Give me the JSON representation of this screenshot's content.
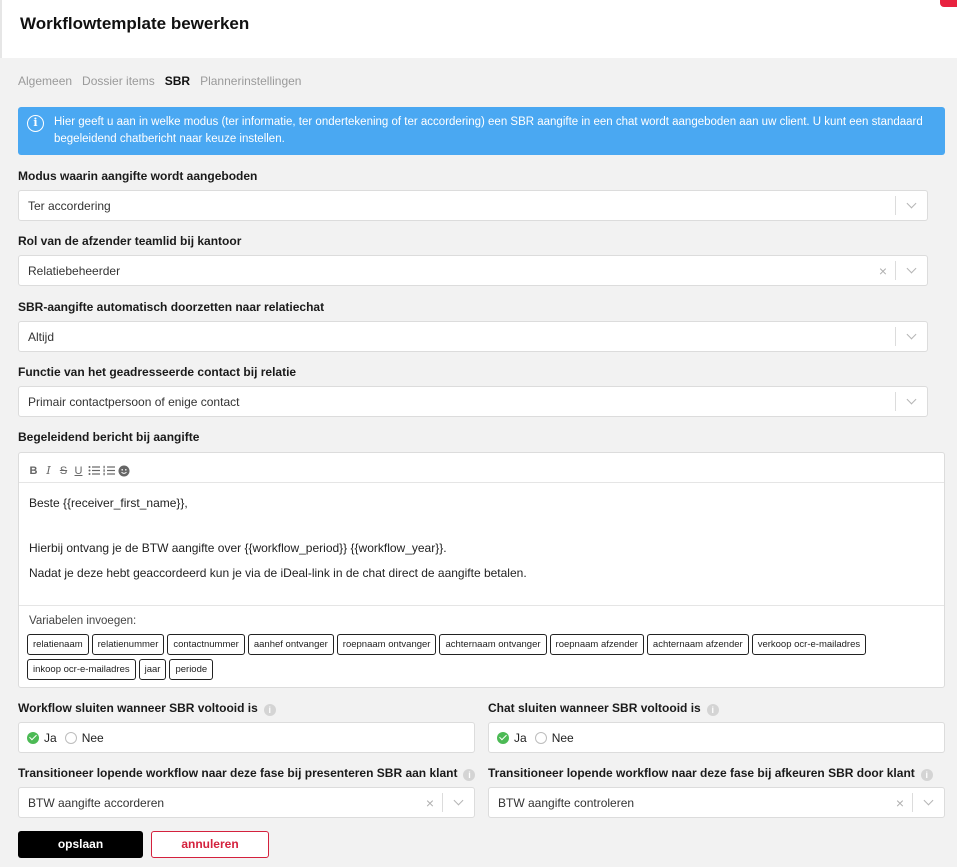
{
  "title": "Workflowtemplate bewerken",
  "tabs": [
    {
      "label": "Algemeen",
      "active": false
    },
    {
      "label": "Dossier items",
      "active": false
    },
    {
      "label": "SBR",
      "active": true
    },
    {
      "label": "Plannerinstellingen",
      "active": false
    }
  ],
  "info": {
    "icon": "info-icon",
    "text": "Hier geeft u aan in welke modus (ter informatie, ter ondertekening of ter accordering) een SBR aangifte in een chat wordt aangeboden aan uw client. U kunt een standaard begeleidend chatbericht naar keuze instellen.",
    "color": "#4aa8f2"
  },
  "fields": {
    "modus": {
      "label": "Modus waarin aangifte wordt aangeboden",
      "value": "Ter accordering"
    },
    "rol": {
      "label": "Rol van de afzender teamlid bij kantoor",
      "value": "Relatiebeheerder",
      "clear": "×"
    },
    "doorzetten": {
      "label": "SBR-aangifte automatisch doorzetten naar relatiechat",
      "value": "Altijd"
    },
    "functie": {
      "label": "Functie van het geadresseerde contact bij relatie",
      "value": "Primair contactpersoon of enige contact"
    }
  },
  "editor": {
    "label": "Begeleidend bericht bij aangifte",
    "toolbar": [
      "B",
      "I",
      "S",
      "U"
    ],
    "message": {
      "line1": "Beste {{receiver_first_name}},",
      "line2": "Hierbij ontvang je de BTW aangifte over {{workflow_period}} {{workflow_year}}.",
      "line3": "Nadat je deze hebt geaccordeerd kun je via de iDeal-link in de chat direct de aangifte betalen."
    },
    "variables_label": "Variabelen invoegen:",
    "variables": [
      "relatienaam",
      "relatienummer",
      "contactnummer",
      "aanhef ontvanger",
      "roepnaam ontvanger",
      "achternaam ontvanger",
      "roepnaam afzender",
      "achternaam afzender",
      "verkoop ocr-e-mailadres",
      "inkoop ocr-e-mailadres",
      "jaar",
      "periode"
    ]
  },
  "workflow_sluiten": {
    "label": "Workflow sluiten wanneer SBR voltooid is",
    "yes": "Ja",
    "no": "Nee",
    "selected": "Ja"
  },
  "chat_sluiten": {
    "label": "Chat sluiten wanneer SBR voltooid is",
    "yes": "Ja",
    "no": "Nee",
    "selected": "Ja"
  },
  "transitie_presenteren": {
    "label": "Transitioneer lopende workflow naar deze fase bij presenteren SBR aan klant",
    "value": "BTW aangifte accorderen",
    "clear": "×"
  },
  "transitie_afkeuren": {
    "label": "Transitioneer lopende workflow naar deze fase bij afkeuren SBR door klant",
    "value": "BTW aangifte controleren",
    "clear": "×"
  },
  "help_glyph": "i",
  "buttons": {
    "save": "opslaan",
    "cancel": "annuleren"
  },
  "colors": {
    "primary_button": "#000000",
    "cancel_button": "#d4213d",
    "success": "#4cba55",
    "accent_corner": "#e8223f"
  }
}
